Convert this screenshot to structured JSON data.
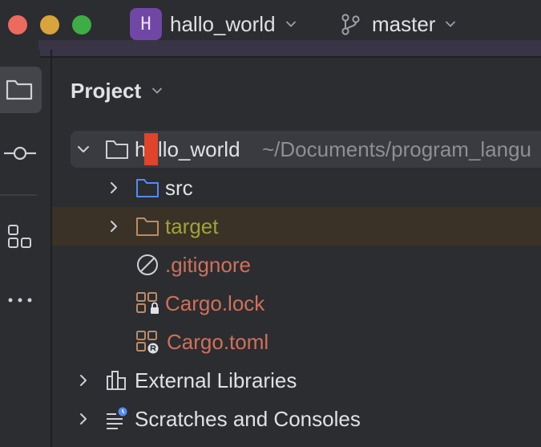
{
  "window": {
    "project_badge": "H",
    "project_name": "hallo_world",
    "branch": "master"
  },
  "panel": {
    "title": "Project"
  },
  "tree": {
    "root": {
      "label": "hello_world",
      "path": "~/Documents/program_langu"
    },
    "src": {
      "label": "src"
    },
    "target": {
      "label": "target"
    },
    "gitignore": {
      "label": ".gitignore"
    },
    "cargo_lock": {
      "label": "Cargo.lock"
    },
    "cargo_toml": {
      "label": "Cargo.toml"
    },
    "external_libraries": {
      "label": "External Libraries"
    },
    "scratches": {
      "label": "Scratches and Consoles"
    }
  },
  "colors": {
    "folder_blue": "#548af7",
    "folder_orange": "#c08a63",
    "target_text": "#a2a13a",
    "ignored_text": "#d0705a",
    "selection": "#393b40",
    "target_row": "#3a3226"
  },
  "icons": {
    "stripe": [
      "folder-icon",
      "commit-icon",
      "structure-icon",
      "more-icon"
    ]
  }
}
